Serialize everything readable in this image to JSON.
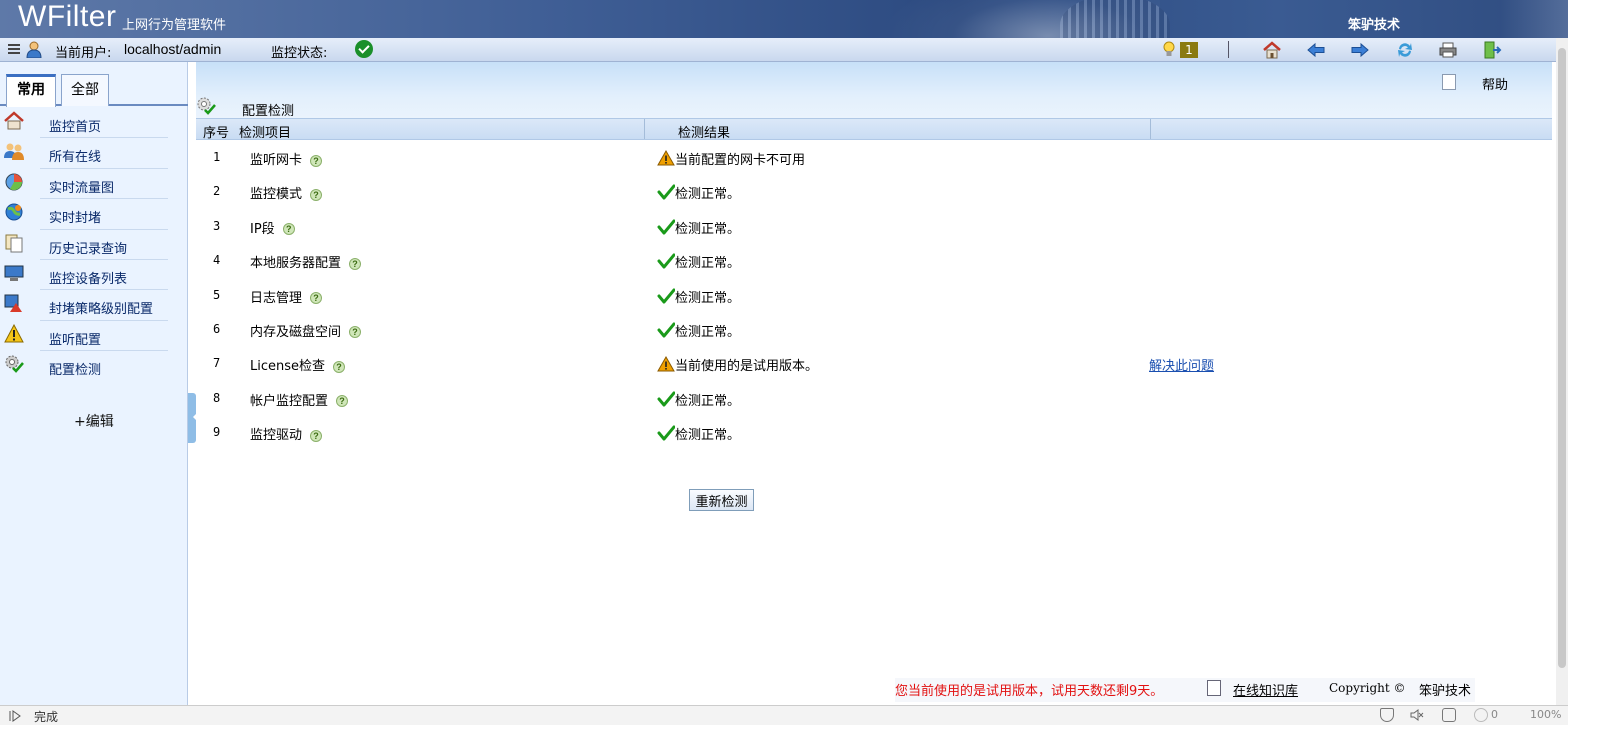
{
  "header": {
    "logo": "WFilter",
    "logo_sub": "上网行为管理软件",
    "company": "笨驴技术"
  },
  "toolbar": {
    "user_label": "当前用户:",
    "user_value": "localhost/admin",
    "status_label": "监控状态:",
    "status_icon": "ok-check-icon",
    "alert_count": "1",
    "buttons": [
      "home-icon",
      "back-icon",
      "forward-icon",
      "refresh-icon",
      "print-icon",
      "logout-icon"
    ]
  },
  "sidebar": {
    "tabs": [
      {
        "label": "常用",
        "active": true
      },
      {
        "label": "全部",
        "active": false
      }
    ],
    "items": [
      {
        "label": "监控首页",
        "icon": "home-icon"
      },
      {
        "label": "所有在线",
        "icon": "users-icon"
      },
      {
        "label": "实时流量图",
        "icon": "pie-chart-icon"
      },
      {
        "label": "实时封堵",
        "icon": "block-globe-icon"
      },
      {
        "label": "历史记录查询",
        "icon": "history-icon"
      },
      {
        "label": "监控设备列表",
        "icon": "monitor-icon"
      },
      {
        "label": "封堵策略级别配置",
        "icon": "policy-icon"
      },
      {
        "label": "监听配置",
        "icon": "warning-icon"
      },
      {
        "label": "配置检测",
        "icon": "config-check-icon"
      }
    ],
    "edit_label": "+编辑"
  },
  "page": {
    "title": "配置检测",
    "help_label": "帮助",
    "columns": [
      "序号",
      "检测项目",
      "检测结果"
    ],
    "rows": [
      {
        "num": "1",
        "item": "监听网卡",
        "status": "warning",
        "result": "当前配置的网卡不可用",
        "action": ""
      },
      {
        "num": "2",
        "item": "监控模式",
        "status": "ok",
        "result": "检测正常。",
        "action": ""
      },
      {
        "num": "3",
        "item": "IP段",
        "status": "ok",
        "result": "检测正常。",
        "action": ""
      },
      {
        "num": "4",
        "item": "本地服务器配置",
        "status": "ok",
        "result": "检测正常。",
        "action": ""
      },
      {
        "num": "5",
        "item": "日志管理",
        "status": "ok",
        "result": "检测正常。",
        "action": ""
      },
      {
        "num": "6",
        "item": "内存及磁盘空间",
        "status": "ok",
        "result": "检测正常。",
        "action": ""
      },
      {
        "num": "7",
        "item": "License检查",
        "status": "warning",
        "result": "当前使用的是试用版本。",
        "action": "解决此问题"
      },
      {
        "num": "8",
        "item": "帐户监控配置",
        "status": "ok",
        "result": "检测正常。",
        "action": ""
      },
      {
        "num": "9",
        "item": "监控驱动",
        "status": "ok",
        "result": "检测正常。",
        "action": ""
      }
    ],
    "help_mark": "?",
    "recheck_label": "重新检测"
  },
  "footer": {
    "trial_text": "您当前使用的是试用版本，试用天数还剩9天。",
    "kb_link": "在线知识库",
    "copyright": "Copyright ©",
    "company": "笨驴技术"
  },
  "statusbar": {
    "text": "完成",
    "count": "0",
    "zoom": "100%"
  },
  "colors": {
    "banner": "#3f5e95",
    "sidebar_bg": "#eaf3ff",
    "ok_green": "#1a9a1a",
    "warning_orange": "#f0a000",
    "link_blue": "#1a4fb0",
    "trial_red": "#e21010"
  }
}
